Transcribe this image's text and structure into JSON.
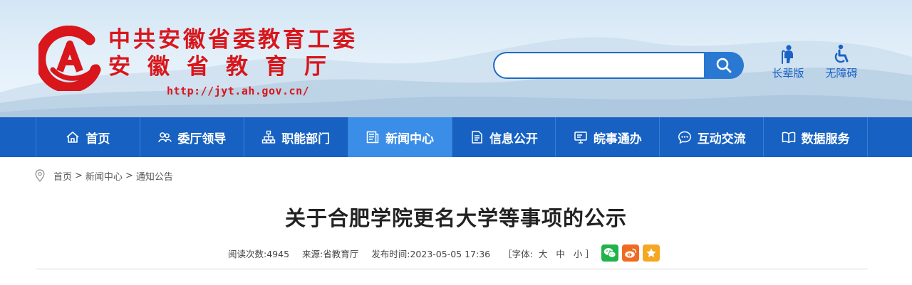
{
  "header": {
    "title_line1": "中共安徽省委教育工委",
    "title_line2": "安徽省教育厅",
    "url": "http://jyt.ah.gov.cn/",
    "search_placeholder": "",
    "tools": [
      {
        "label": "长辈版",
        "icon": "elder-mode-icon"
      },
      {
        "label": "无障碍",
        "icon": "accessibility-icon"
      }
    ]
  },
  "nav": {
    "items": [
      {
        "label": "首页",
        "icon": "home-icon"
      },
      {
        "label": "委厅领导",
        "icon": "leaders-icon"
      },
      {
        "label": "职能部门",
        "icon": "org-chart-icon"
      },
      {
        "label": "新闻中心",
        "icon": "news-icon"
      },
      {
        "label": "信息公开",
        "icon": "document-icon"
      },
      {
        "label": "皖事通办",
        "icon": "monitor-icon"
      },
      {
        "label": "互动交流",
        "icon": "chat-icon"
      },
      {
        "label": "数据服务",
        "icon": "book-icon"
      }
    ],
    "active_index": 3
  },
  "breadcrumb": {
    "items": [
      "首页",
      "新闻中心",
      "通知公告"
    ],
    "separator": ">"
  },
  "article": {
    "title": "关于合肥学院更名大学等事项的公示",
    "meta": {
      "views_label": "阅读次数:",
      "views": "4945",
      "source_label": "来源:",
      "source": "省教育厅",
      "published_label": "发布时间:",
      "published": "2023-05-05 17:36",
      "font_open": "［字体:",
      "font_large": "大",
      "font_medium": "中",
      "font_small": "小",
      "font_close": "］"
    },
    "share": [
      "wechat-icon",
      "weibo-icon",
      "favorite-icon"
    ]
  },
  "colors": {
    "brand_red": "#d8161b",
    "nav_blue": "#1661c2",
    "nav_active": "#3b8ee8",
    "accent_blue": "#1a62c4"
  }
}
